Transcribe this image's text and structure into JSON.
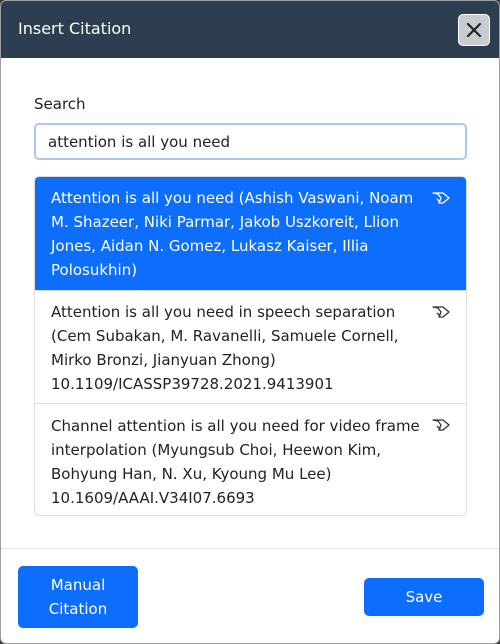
{
  "dialog": {
    "title": "Insert Citation",
    "close_icon": "close-x-icon"
  },
  "search": {
    "label": "Search",
    "value": "attention is all you need",
    "icon_note": "none"
  },
  "results": [
    {
      "text": "Attention is all you need (Ashish Vaswani, Noam M. Shazeer, Niki Parmar, Jakob Uszkoreit, Llion Jones, Aidan N. Gomez, Lukasz Kaiser, Illia Polosukhin)",
      "doi": "",
      "selected": true,
      "icon": "ai-sparkle-icon"
    },
    {
      "text": "Attention is all you need in speech separation (Cem Subakan, M. Ravanelli, Samuele Cornell, Mirko Bronzi, Jianyuan Zhong)",
      "doi": "10.1109/ICASSP39728.2021.9413901",
      "selected": false,
      "icon": "ai-sparkle-icon"
    },
    {
      "text": "Channel attention is all you need for video frame interpolation (Myungsub Choi, Heewon Kim, Bohyung Han, N. Xu, Kyoung Mu Lee)",
      "doi": "10.1609/AAAI.V34I07.6693",
      "selected": false,
      "icon": "ai-sparkle-icon"
    }
  ],
  "footer": {
    "manual_label": "Manual\nCitation",
    "save_label": "Save"
  },
  "colors": {
    "titlebar": "#2c3e50",
    "accent": "#0d6efd",
    "close_button": "#c8ccd0"
  }
}
